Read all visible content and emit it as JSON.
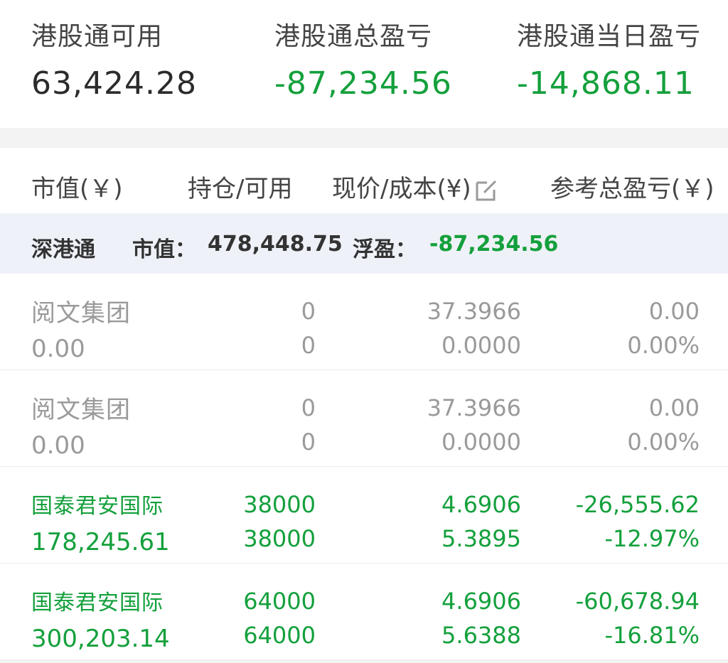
{
  "summary": {
    "available_label": "港股通可用",
    "available_value": "63,424.28",
    "total_pl_label": "港股通总盈亏",
    "total_pl_value": "-87,234.56",
    "daily_pl_label": "港股通当日盈亏",
    "daily_pl_value": "-14,868.11"
  },
  "header": {
    "market_value": "市值(￥)",
    "position": "持仓/可用",
    "price_cost": "现价/成本(¥)",
    "ref_pl": "参考总盈亏(￥)"
  },
  "group": {
    "name": "深港通",
    "mv_label": "市值：",
    "mv_value": "478,448.75",
    "float_label": "浮盈：",
    "float_value": "-87,234.56"
  },
  "rows": [
    {
      "name": "阅文集团",
      "market_value": "0.00",
      "hold": "0",
      "avail": "0",
      "price": "37.3966",
      "cost": "0.0000",
      "pl": "0.00",
      "pl_pct": "0.00%"
    },
    {
      "name": "阅文集团",
      "market_value": "0.00",
      "hold": "0",
      "avail": "0",
      "price": "37.3966",
      "cost": "0.0000",
      "pl": "0.00",
      "pl_pct": "0.00%"
    },
    {
      "name": "国泰君安国际",
      "market_value": "178,245.61",
      "hold": "38000",
      "avail": "38000",
      "price": "4.6906",
      "cost": "5.3895",
      "pl": "-26,555.62",
      "pl_pct": "-12.97%"
    },
    {
      "name": "国泰君安国际",
      "market_value": "300,203.14",
      "hold": "64000",
      "avail": "64000",
      "price": "4.6906",
      "cost": "5.6388",
      "pl": "-60,678.94",
      "pl_pct": "-16.81%"
    }
  ],
  "colors": {
    "gain_loss_green": "#14a03c",
    "group_bar_bg": "#eef1f7",
    "muted_text": "#9a9a9a"
  },
  "icons": {
    "edit": "edit-cost-icon"
  }
}
